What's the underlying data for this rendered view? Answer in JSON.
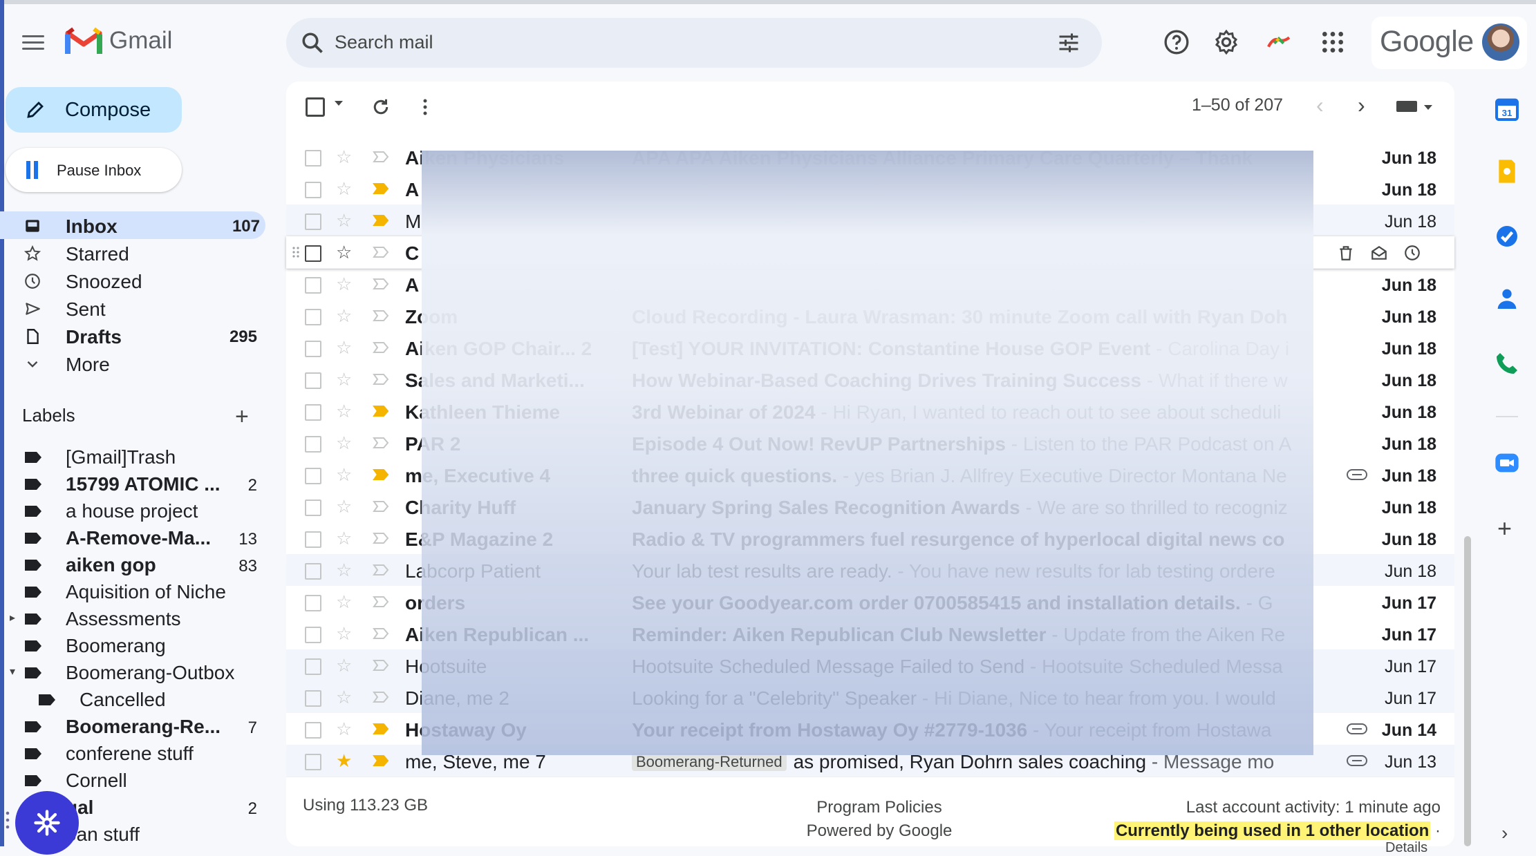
{
  "app": {
    "name": "Gmail"
  },
  "header": {
    "search_placeholder": "Search mail",
    "google_wordmark": "Google"
  },
  "compose": {
    "label": "Compose"
  },
  "pause_inbox": {
    "label": "Pause Inbox"
  },
  "nav": [
    {
      "label": "Inbox",
      "count": "107",
      "bold": true,
      "active": true,
      "icon": "inbox-icon"
    },
    {
      "label": "Starred",
      "count": "",
      "bold": false,
      "icon": "star-icon"
    },
    {
      "label": "Snoozed",
      "count": "",
      "bold": false,
      "icon": "clock-icon"
    },
    {
      "label": "Sent",
      "count": "",
      "bold": false,
      "icon": "send-icon"
    },
    {
      "label": "Drafts",
      "count": "295",
      "bold": true,
      "icon": "draft-icon"
    },
    {
      "label": "More",
      "count": "",
      "bold": false,
      "icon": "chevron-down-icon"
    }
  ],
  "labels_section": {
    "title": "Labels",
    "items": [
      {
        "label": "[Gmail]Trash",
        "count": "",
        "bold": false
      },
      {
        "label": "15799 ATOMIC ...",
        "count": "2",
        "bold": true
      },
      {
        "label": "a house project",
        "count": "",
        "bold": false
      },
      {
        "label": "A-Remove-Ma...",
        "count": "13",
        "bold": true
      },
      {
        "label": "aiken gop",
        "count": "83",
        "bold": true
      },
      {
        "label": "Aquisition of Niche",
        "count": "",
        "bold": false
      },
      {
        "label": "Assessments",
        "count": "",
        "bold": false
      },
      {
        "label": "Boomerang",
        "count": "",
        "bold": false
      },
      {
        "label": "Boomerang-Outbox",
        "count": "",
        "bold": false
      },
      {
        "label": "Cancelled",
        "count": "",
        "bold": false
      },
      {
        "label": "Boomerang-Re...",
        "count": "7",
        "bold": true
      },
      {
        "label": "conferene stuff",
        "count": "",
        "bold": false
      },
      {
        "label": "Cornell",
        "count": "",
        "bold": false
      },
      {
        "label": "gal",
        "count": "2",
        "bold": true
      },
      {
        "label": "oan stuff",
        "count": "",
        "bold": false
      }
    ]
  },
  "toolbar": {
    "pagination": "1–50 of 207"
  },
  "emails": [
    {
      "sender": "Aiken Physicians",
      "subject": "APA APA Aiken Physicians Alliance Primary Care Quarterly – Thank",
      "snippet": "",
      "date": "Jun 18",
      "unread": true,
      "important": false,
      "starred": false,
      "attachment": false,
      "label": ""
    },
    {
      "sender": "A",
      "subject": "",
      "snippet": "",
      "date": "Jun 18",
      "unread": true,
      "important": true,
      "starred": false,
      "attachment": false,
      "label": ""
    },
    {
      "sender": "M",
      "subject": "",
      "snippet": "",
      "date": "Jun 18",
      "unread": false,
      "important": true,
      "starred": false,
      "attachment": false,
      "label": ""
    },
    {
      "sender": "C",
      "subject": "",
      "snippet": "",
      "date": "",
      "unread": true,
      "important": false,
      "starred": false,
      "attachment": false,
      "label": "",
      "hover": true
    },
    {
      "sender": "A",
      "subject": "",
      "snippet": "",
      "date": "Jun 18",
      "unread": true,
      "important": false,
      "starred": false,
      "attachment": false,
      "label": ""
    },
    {
      "sender": "Zoom",
      "subject": "Cloud Recording - Laura Wrasman: 30 minute Zoom call with Ryan Doh",
      "snippet": "",
      "date": "Jun 18",
      "unread": true,
      "important": false,
      "starred": false,
      "attachment": false,
      "label": ""
    },
    {
      "sender": "Aiken GOP Chair... 2",
      "subject": "[Test] YOUR INVITATION: Constantine House GOP Event",
      "snippet": " - Carolina Day i",
      "date": "Jun 18",
      "unread": true,
      "important": false,
      "starred": false,
      "attachment": false,
      "label": ""
    },
    {
      "sender": "Sales and Marketi...",
      "subject": "How Webinar-Based Coaching Drives Training Success",
      "snippet": " - What if there w",
      "date": "Jun 18",
      "unread": true,
      "important": false,
      "starred": false,
      "attachment": false,
      "label": ""
    },
    {
      "sender": "Kathleen Thieme",
      "subject": "3rd Webinar of 2024",
      "snippet": " - Hi Ryan, I wanted to reach out to see about scheduli",
      "date": "Jun 18",
      "unread": true,
      "important": true,
      "starred": false,
      "attachment": false,
      "label": ""
    },
    {
      "sender": "PAR 2",
      "subject": "Episode 4 Out Now! RevUP Partnerships",
      "snippet": " - Listen to the PAR Podcast on A",
      "date": "Jun 18",
      "unread": true,
      "important": false,
      "starred": false,
      "attachment": false,
      "label": ""
    },
    {
      "sender": "me, Executive 4",
      "subject": "three quick questions.",
      "snippet": " - yes Brian J. Allfrey Executive Director Montana Ne",
      "date": "Jun 18",
      "unread": true,
      "important": true,
      "starred": false,
      "attachment": true,
      "label": ""
    },
    {
      "sender": "Charity Huff",
      "subject": "January Spring Sales Recognition Awards",
      "snippet": " - We are so thrilled to recogniz",
      "date": "Jun 18",
      "unread": true,
      "important": false,
      "starred": false,
      "attachment": false,
      "label": ""
    },
    {
      "sender": "E&P Magazine 2",
      "subject": "Radio & TV programmers fuel resurgence of hyperlocal digital news co",
      "snippet": "",
      "date": "Jun 18",
      "unread": true,
      "important": false,
      "starred": false,
      "attachment": false,
      "label": ""
    },
    {
      "sender": "Labcorp Patient",
      "subject": "Your lab test results are ready.",
      "snippet": " - You have new results for lab testing ordere",
      "date": "Jun 18",
      "unread": false,
      "important": false,
      "starred": false,
      "attachment": false,
      "label": ""
    },
    {
      "sender": "orders",
      "subject": "See your Goodyear.com order 0700585415 and installation details.",
      "snippet": " - G",
      "date": "Jun 17",
      "unread": true,
      "important": false,
      "starred": false,
      "attachment": false,
      "label": ""
    },
    {
      "sender": "Aiken Republican ...",
      "subject": "Reminder: Aiken Republican Club Newsletter",
      "snippet": " - Update from the Aiken Re",
      "date": "Jun 17",
      "unread": true,
      "important": false,
      "starred": false,
      "attachment": false,
      "label": ""
    },
    {
      "sender": "Hootsuite",
      "subject": "Hootsuite Scheduled Message Failed to Send",
      "snippet": " - Hootsuite Scheduled Messa",
      "date": "Jun 17",
      "unread": false,
      "important": false,
      "starred": false,
      "attachment": false,
      "label": ""
    },
    {
      "sender": "Diane, me 2",
      "subject": "Looking for a \"Celebrity\" Speaker",
      "snippet": " - Hi Diane, Nice to hear from you. I would",
      "date": "Jun 17",
      "unread": false,
      "important": false,
      "starred": false,
      "attachment": false,
      "label": ""
    },
    {
      "sender": "Hostaway Oy",
      "subject": "Your receipt from Hostaway Oy #2779-1036",
      "snippet": " - Your receipt from Hostawa",
      "date": "Jun 14",
      "unread": true,
      "important": true,
      "starred": false,
      "attachment": true,
      "label": ""
    },
    {
      "sender": "me, Steve, me 7",
      "subject": "as promised, Ryan Dohrn sales coaching",
      "snippet": " - Message mo",
      "date": "Jun 13",
      "unread": false,
      "important": true,
      "starred": true,
      "attachment": true,
      "label": "Boomerang-Returned"
    }
  ],
  "footer": {
    "usage": "Using 113.23 GB",
    "program_policies": "Program Policies",
    "powered_by": "Powered by Google",
    "last_activity": "Last account activity: 1 minute ago",
    "other_location": "Currently being used in 1 other location",
    "details": "Details"
  },
  "colors": {
    "accent": "#1a73e8",
    "compose_bg": "#c2e7ff",
    "active_nav": "#d3e3fd",
    "important": "#f4b400",
    "fab": "#3c3ad6"
  }
}
